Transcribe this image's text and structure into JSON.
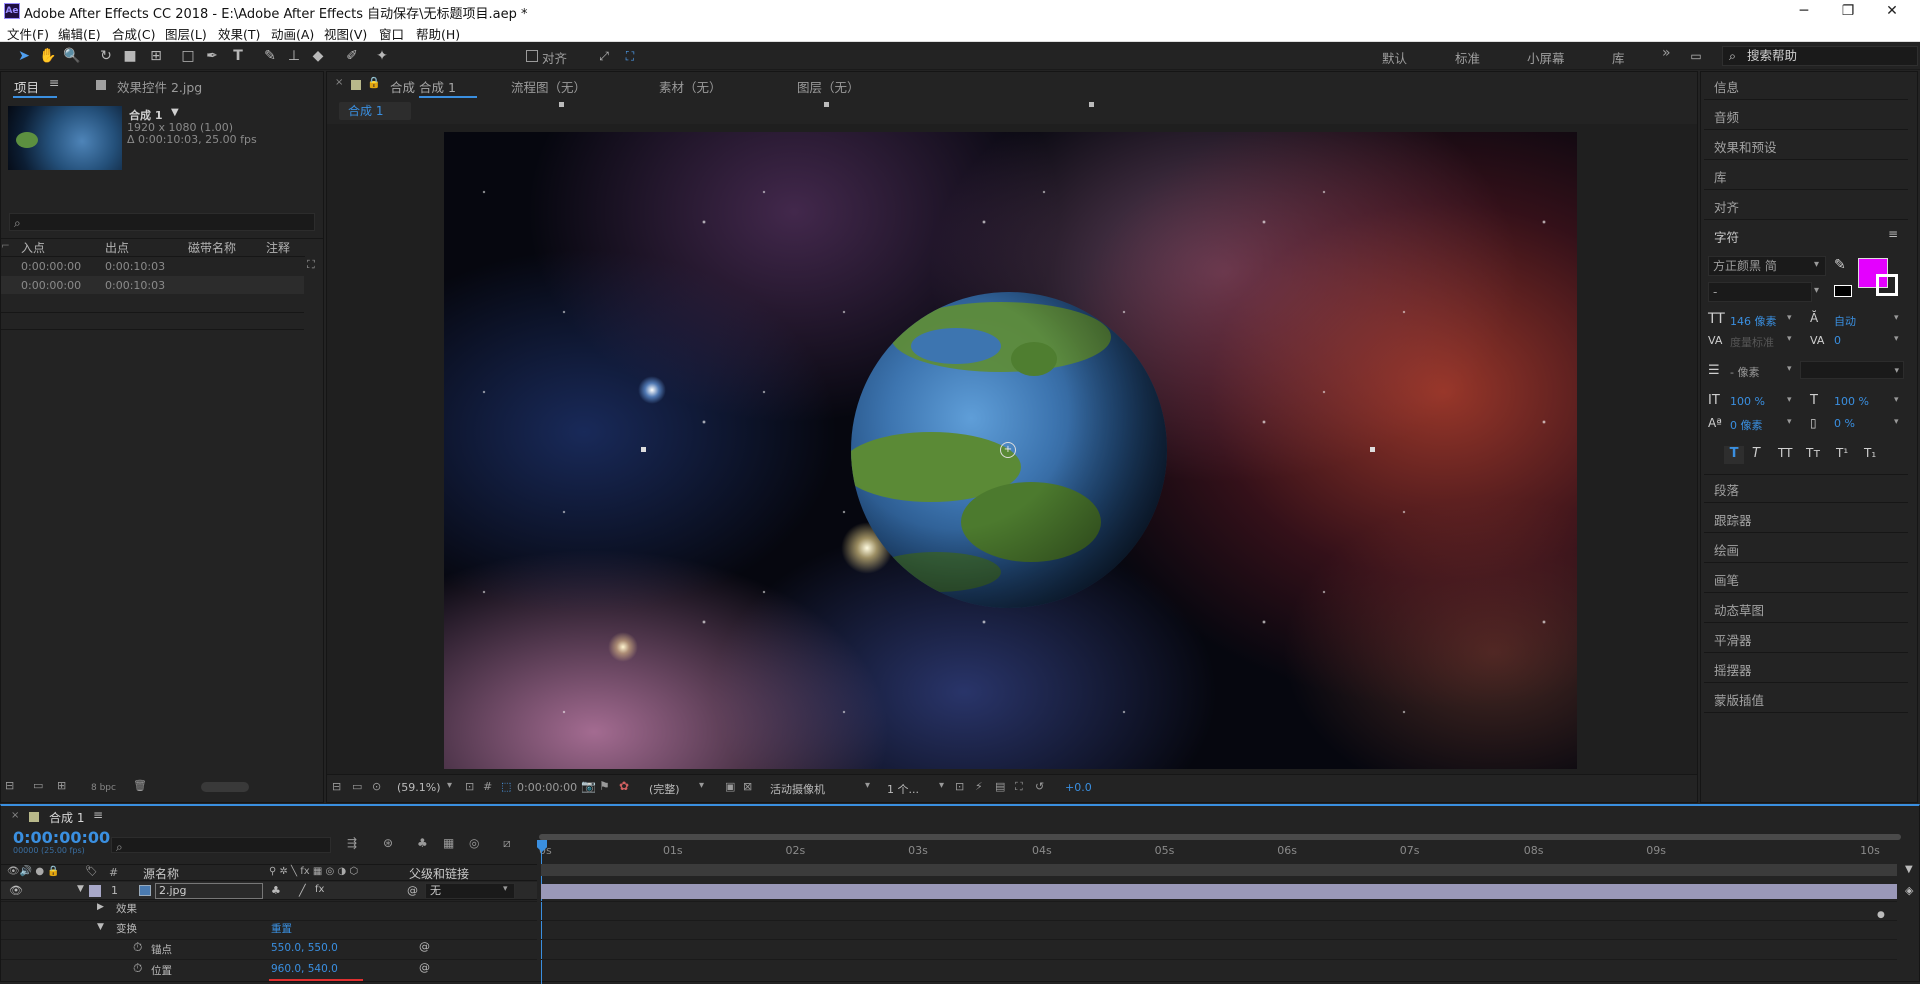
{
  "window": {
    "title": "Adobe After Effects CC 2018 - E:\\Adobe After Effects 自动保存\\无标题项目.aep *",
    "logo": "Ae"
  },
  "window_buttons": {
    "minimize": "─",
    "maximize": "❐",
    "close": "✕"
  },
  "menu": [
    "文件(F)",
    "编辑(E)",
    "合成(C)",
    "图层(L)",
    "效果(T)",
    "动画(A)",
    "视图(V)",
    "窗口",
    "帮助(H)"
  ],
  "toolbar": {
    "align_label": "对齐",
    "workspaces": [
      "默认",
      "标准",
      "小屏幕",
      "库"
    ],
    "more": "»",
    "help_search": "搜索帮助"
  },
  "project": {
    "tab": "项目",
    "effects_tab": "效果控件 2.jpg",
    "comp_name": "合成 1",
    "comp_res": "1920 x 1080 (1.00)",
    "comp_dur": "Δ 0:00:10:03, 25.00 fps",
    "search_icon": "⌕",
    "columns": [
      "入点",
      "出点",
      "磁带名称",
      "注释"
    ],
    "rows": [
      [
        "0:00:00:00",
        "0:00:10:03"
      ],
      [
        "0:00:00:00",
        "0:00:10:03"
      ]
    ],
    "bpc": "8 bpc"
  },
  "viewer": {
    "tabs": [
      "合成 合成 1",
      "流程图（无）",
      "素材（无）",
      "图层（无）"
    ],
    "active_comp": "合成 1",
    "crumb": "合成 1",
    "zoom": "(59.1%)",
    "timecode": "0:00:00:00",
    "quality": "(完整)",
    "camera": "活动摄像机",
    "views": "1 个...",
    "exposure": "+0.0"
  },
  "right_panel": {
    "items_top": [
      "信息",
      "音频",
      "效果和预设",
      "库",
      "对齐"
    ],
    "character": "字符",
    "font": "方正颜黑 简",
    "font_style": "-",
    "size": "146 像素",
    "leading": "自动",
    "kerning": "度量标准",
    "tracking": "0",
    "stroke": "- 像素",
    "v_scale": "100 %",
    "h_scale": "100 %",
    "baseline": "0 像素",
    "tsume": "0 %",
    "fill_color": "#e400ff",
    "items_bottom": [
      "段落",
      "跟踪器",
      "绘画",
      "画笔",
      "动态草图",
      "平滑器",
      "摇摆器",
      "蒙版插值"
    ]
  },
  "timeline": {
    "tab": "合成 1",
    "timecode": "0:00:00:00",
    "fps": "00000 (25.00 fps)",
    "col_source": "源名称",
    "col_parent": "父级和链接",
    "col_num": "#",
    "layer_num": "1",
    "layer_name": "2.jpg",
    "layer_parent": "无",
    "effects": "效果",
    "transform": "变换",
    "reset": "重置",
    "anchor": "锚点",
    "anchor_val": "550.0, 550.0",
    "position": "位置",
    "position_val": "960.0, 540.0",
    "ruler": [
      "0s",
      "01s",
      "02s",
      "03s",
      "04s",
      "05s",
      "06s",
      "07s",
      "08s",
      "09s",
      "10s"
    ]
  }
}
